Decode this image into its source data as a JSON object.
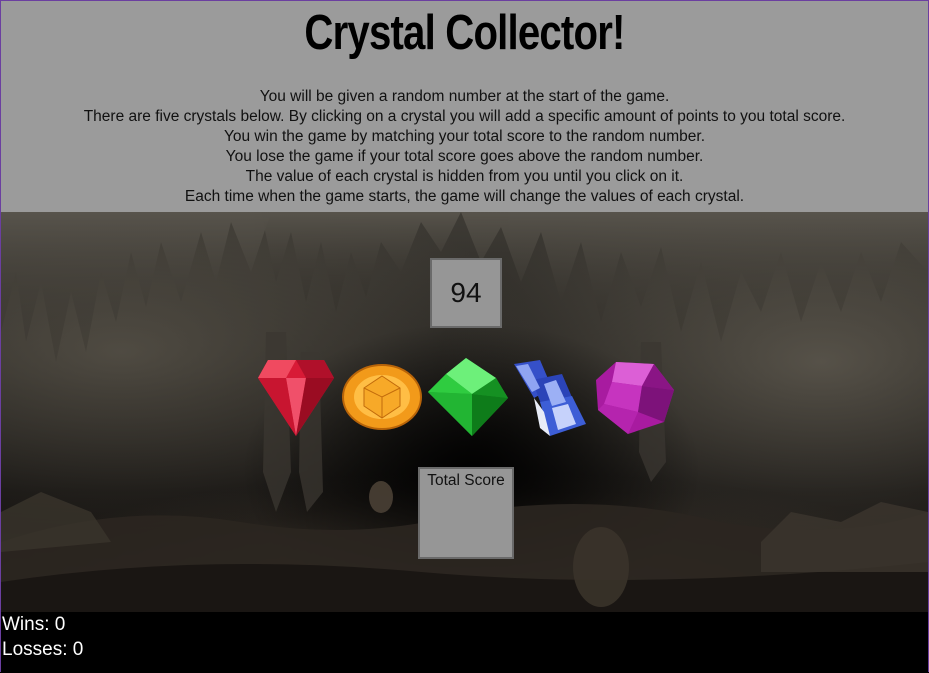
{
  "game": {
    "title": "Crystal Collector!",
    "rules": [
      "You will be given a random number at the start of the game.",
      "There are five crystals below. By clicking on a crystal you will add a specific amount of points to you total score.",
      "You win the game by matching your total score to the random number.",
      "You lose the game if your total score goes above the random number.",
      "The value of each crystal is hidden from you until you click on it.",
      "Each time when the game starts, the game will change the values of each crystal."
    ],
    "target_number": "94",
    "total_score_label": "Total Score",
    "total_score_value": "",
    "crystals": [
      {
        "name": "red-crystal",
        "color": "#e0203a"
      },
      {
        "name": "orange-crystal",
        "color": "#f39a1b"
      },
      {
        "name": "green-crystal",
        "color": "#27c43a"
      },
      {
        "name": "blue-crystal",
        "color": "#2f49c9"
      },
      {
        "name": "purple-crystal",
        "color": "#b21ca8"
      }
    ]
  },
  "stats": {
    "wins_label": "Wins: 0",
    "losses_label": "Losses: 0"
  },
  "colors": {
    "header_bg": "#9b9b9b",
    "box_bg": "#969696",
    "footer_bg": "#000000"
  }
}
